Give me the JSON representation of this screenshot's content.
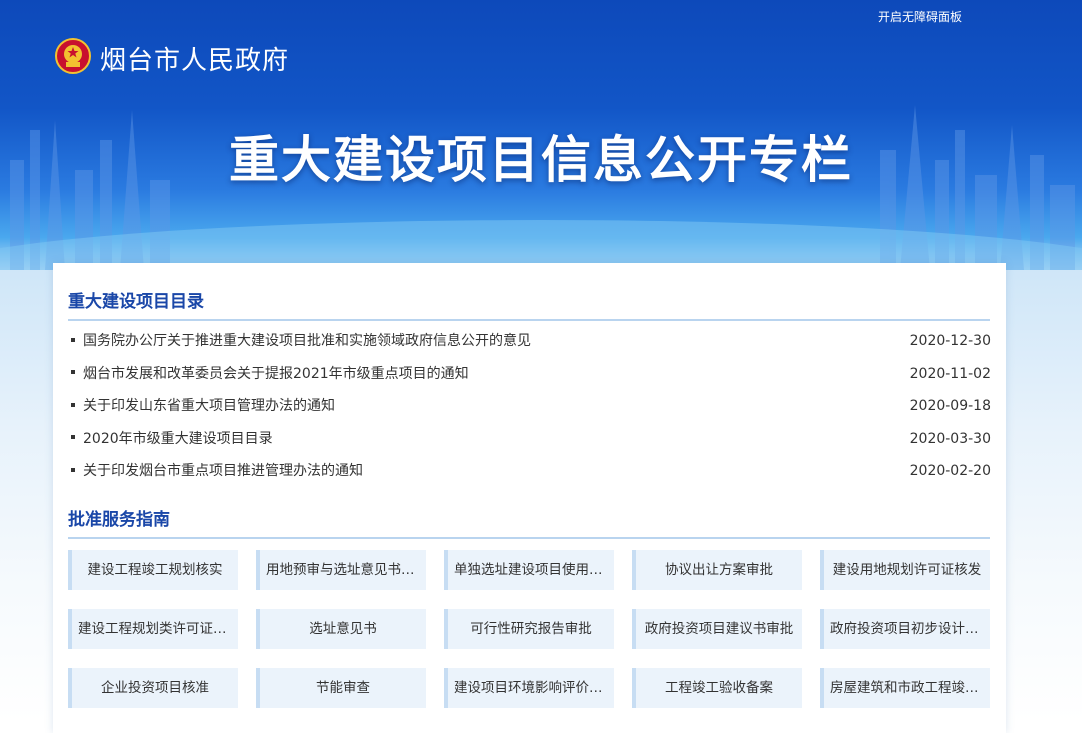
{
  "header": {
    "accessibility_link": "开启无障碍面板",
    "site_name": "烟台市人民政府",
    "hero_title": "重大建设项目信息公开专栏"
  },
  "sections": {
    "catalog_title": "重大建设项目目录",
    "guide_title": "批准服务指南"
  },
  "news": [
    {
      "title": "国务院办公厅关于推进重大建设项目批准和实施领域政府信息公开的意见",
      "date": "2020-12-30"
    },
    {
      "title": "烟台市发展和改革委员会关于提报2021年市级重点项目的通知",
      "date": "2020-11-02"
    },
    {
      "title": "关于印发山东省重大项目管理办法的通知",
      "date": "2020-09-18"
    },
    {
      "title": "2020年市级重大建设项目目录",
      "date": "2020-03-30"
    },
    {
      "title": "关于印发烟台市重点项目推进管理办法的通知",
      "date": "2020-02-20"
    }
  ],
  "guides": [
    "建设工程竣工规划核实",
    "用地预审与选址意见书审批",
    "单独选址建设项目使用土...",
    "协议出让方案审批",
    "建设用地规划许可证核发",
    "建设工程规划类许可证核发",
    "选址意见书",
    "可行性研究报告审批",
    "政府投资项目建议书审批",
    "政府投资项目初步设计概...",
    "企业投资项目核准",
    "节能审查",
    "建设项目环境影响评价审批",
    "工程竣工验收备案",
    "房屋建筑和市政工程竣工..."
  ],
  "icons": {
    "logo": "national-emblem-icon"
  },
  "colors": {
    "banner_blue": "#1256c7",
    "title_blue": "#1a47a8",
    "cell_bg": "#ebf3fb"
  }
}
